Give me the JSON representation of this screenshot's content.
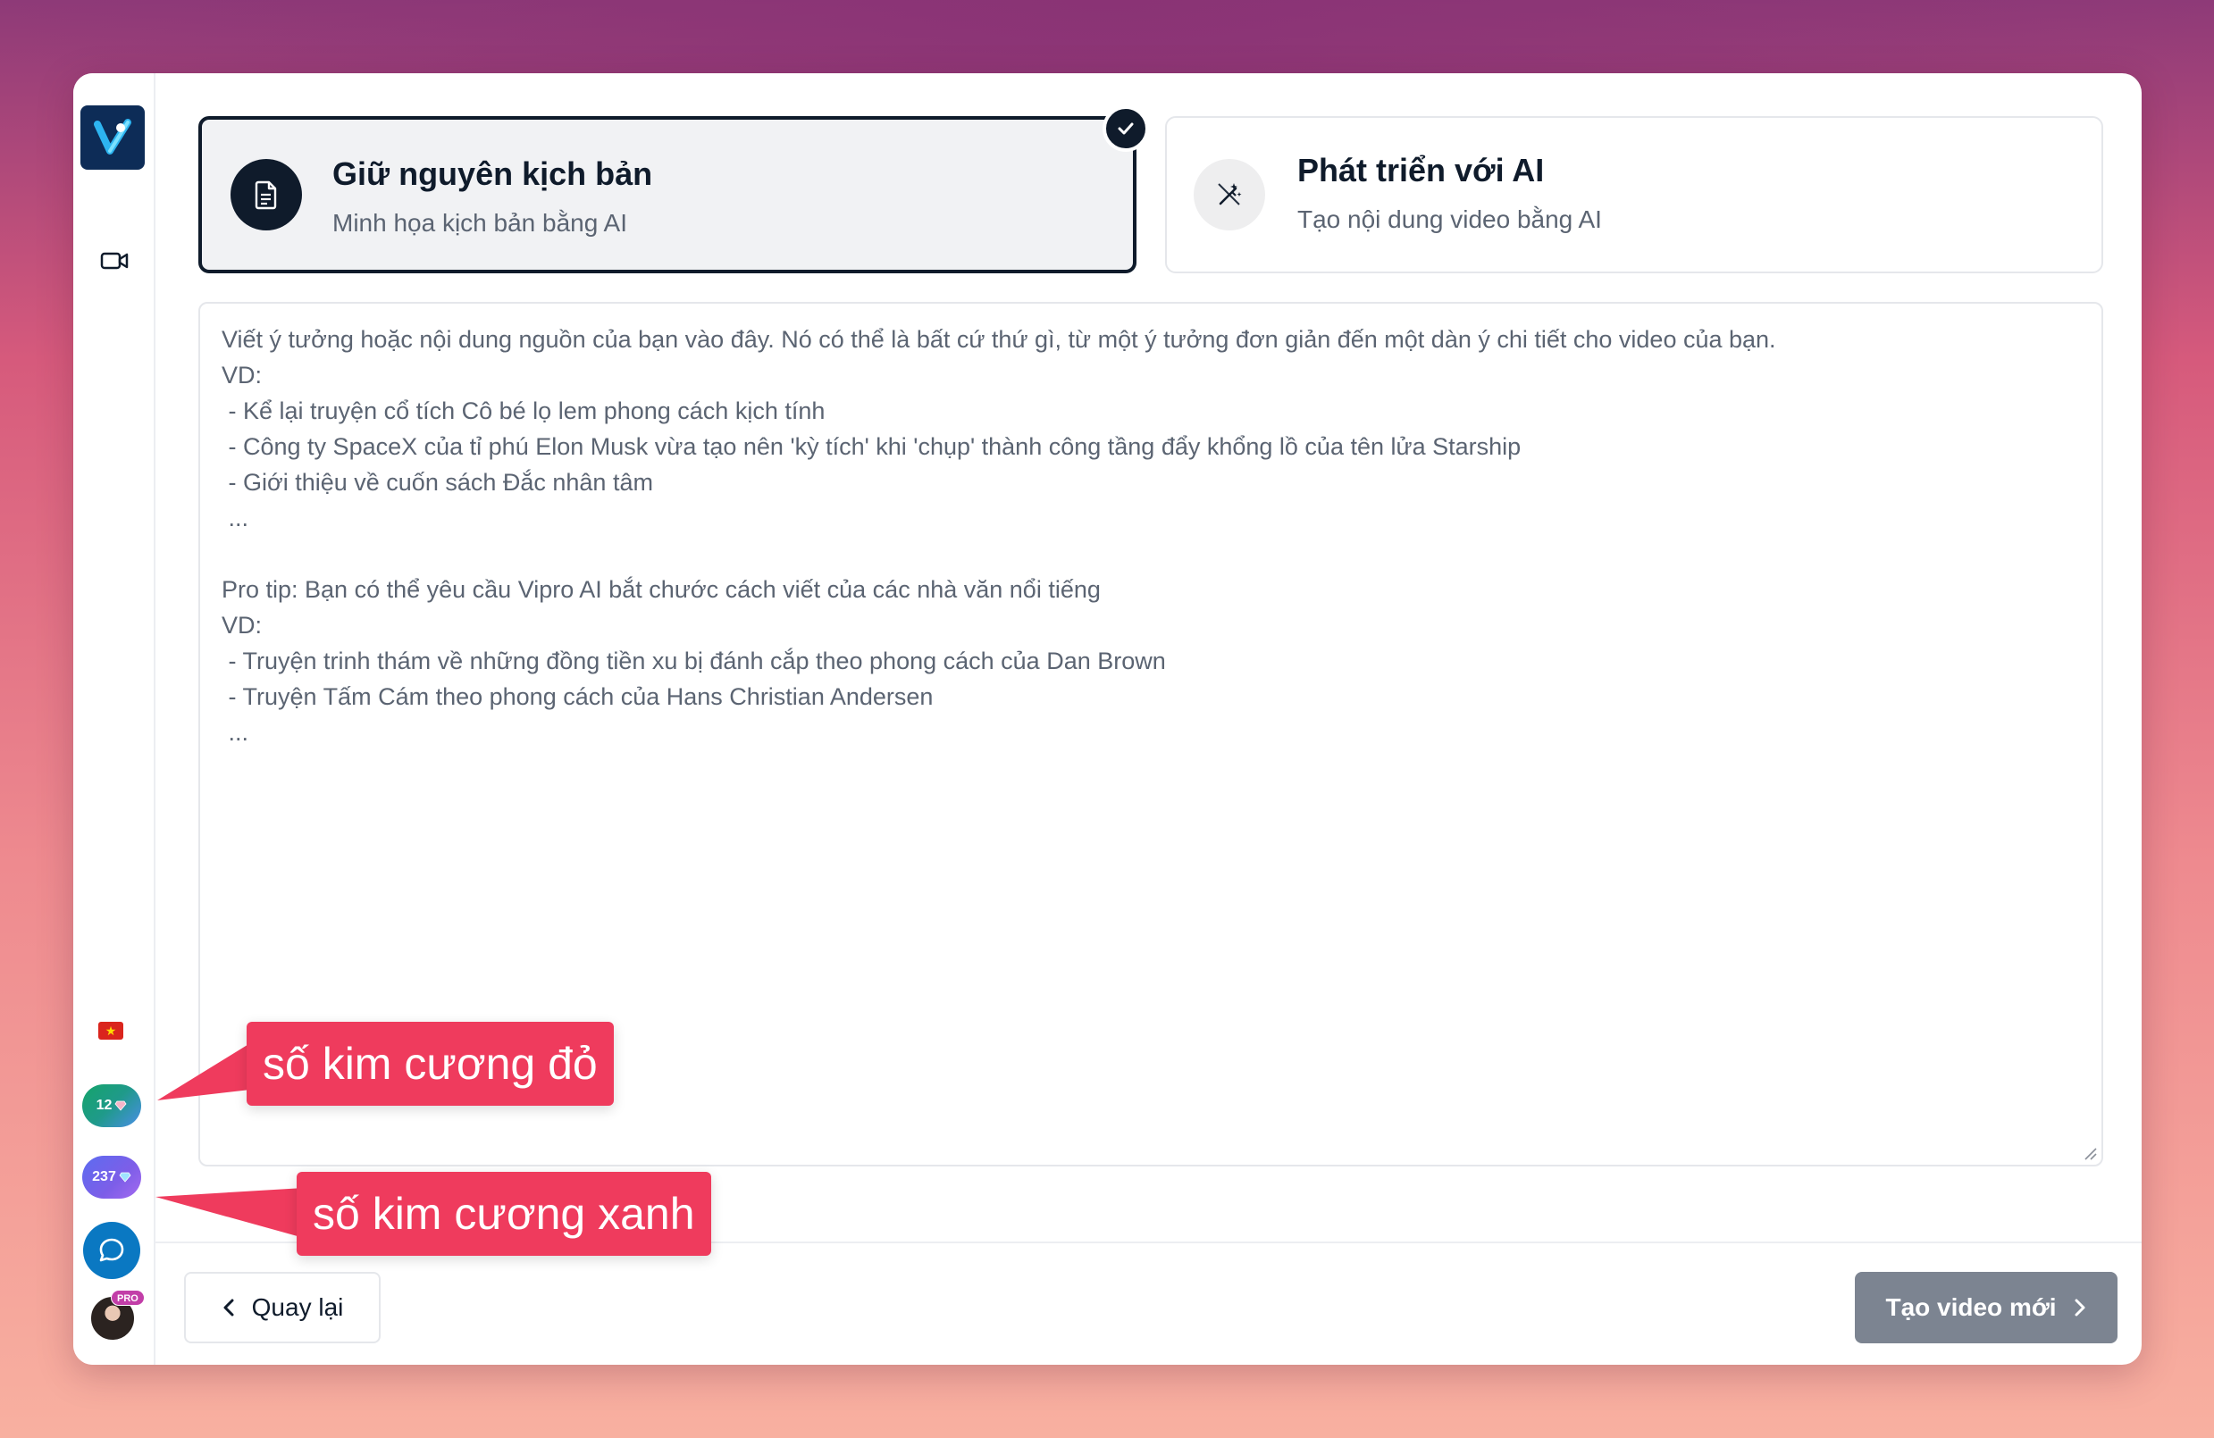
{
  "selected_mode": {
    "title": "Giữ nguyên kịch bản",
    "subtitle": "Minh họa kịch bản bằng AI"
  },
  "other_mode": {
    "title": "Phát triển với AI",
    "subtitle": "Tạo nội dung video bằng AI"
  },
  "prompt": {
    "placeholder": "Viết ý tưởng hoặc nội dung nguồn của bạn vào đây. Nó có thể là bất cứ thứ gì, từ một ý tưởng đơn giản đến một dàn ý chi tiết cho video của bạn.\nVD:\n - Kể lại truyện cổ tích Cô bé lọ lem phong cách kịch tính\n - Công ty SpaceX của tỉ phú Elon Musk vừa tạo nên 'kỳ tích' khi 'chụp' thành công tầng đẩy khổng lồ của tên lửa Starship\n - Giới thiệu về cuốn sách Đắc nhân tâm\n ...\n\nPro tip: Bạn có thể yêu cầu Vipro AI bắt chước cách viết của các nhà văn nổi tiếng\nVD:\n - Truyện trinh thám về những đồng tiền xu bị đánh cắp theo phong cách của Dan Brown\n - Truyện Tấm Cám theo phong cách của Hans Christian Andersen\n ..."
  },
  "sidebar": {
    "red_diamonds": "12",
    "blue_diamonds": "237",
    "pro_label": "PRO"
  },
  "footer": {
    "back_label": "Quay lại",
    "create_label": "Tạo video mới"
  },
  "annotations": {
    "red_label": "số kim cương đỏ",
    "blue_label": "số kim cương xanh"
  },
  "colors": {
    "accent_dark": "#0f1b2b",
    "callout": "#ef3b5d",
    "chat": "#0a78c2"
  }
}
